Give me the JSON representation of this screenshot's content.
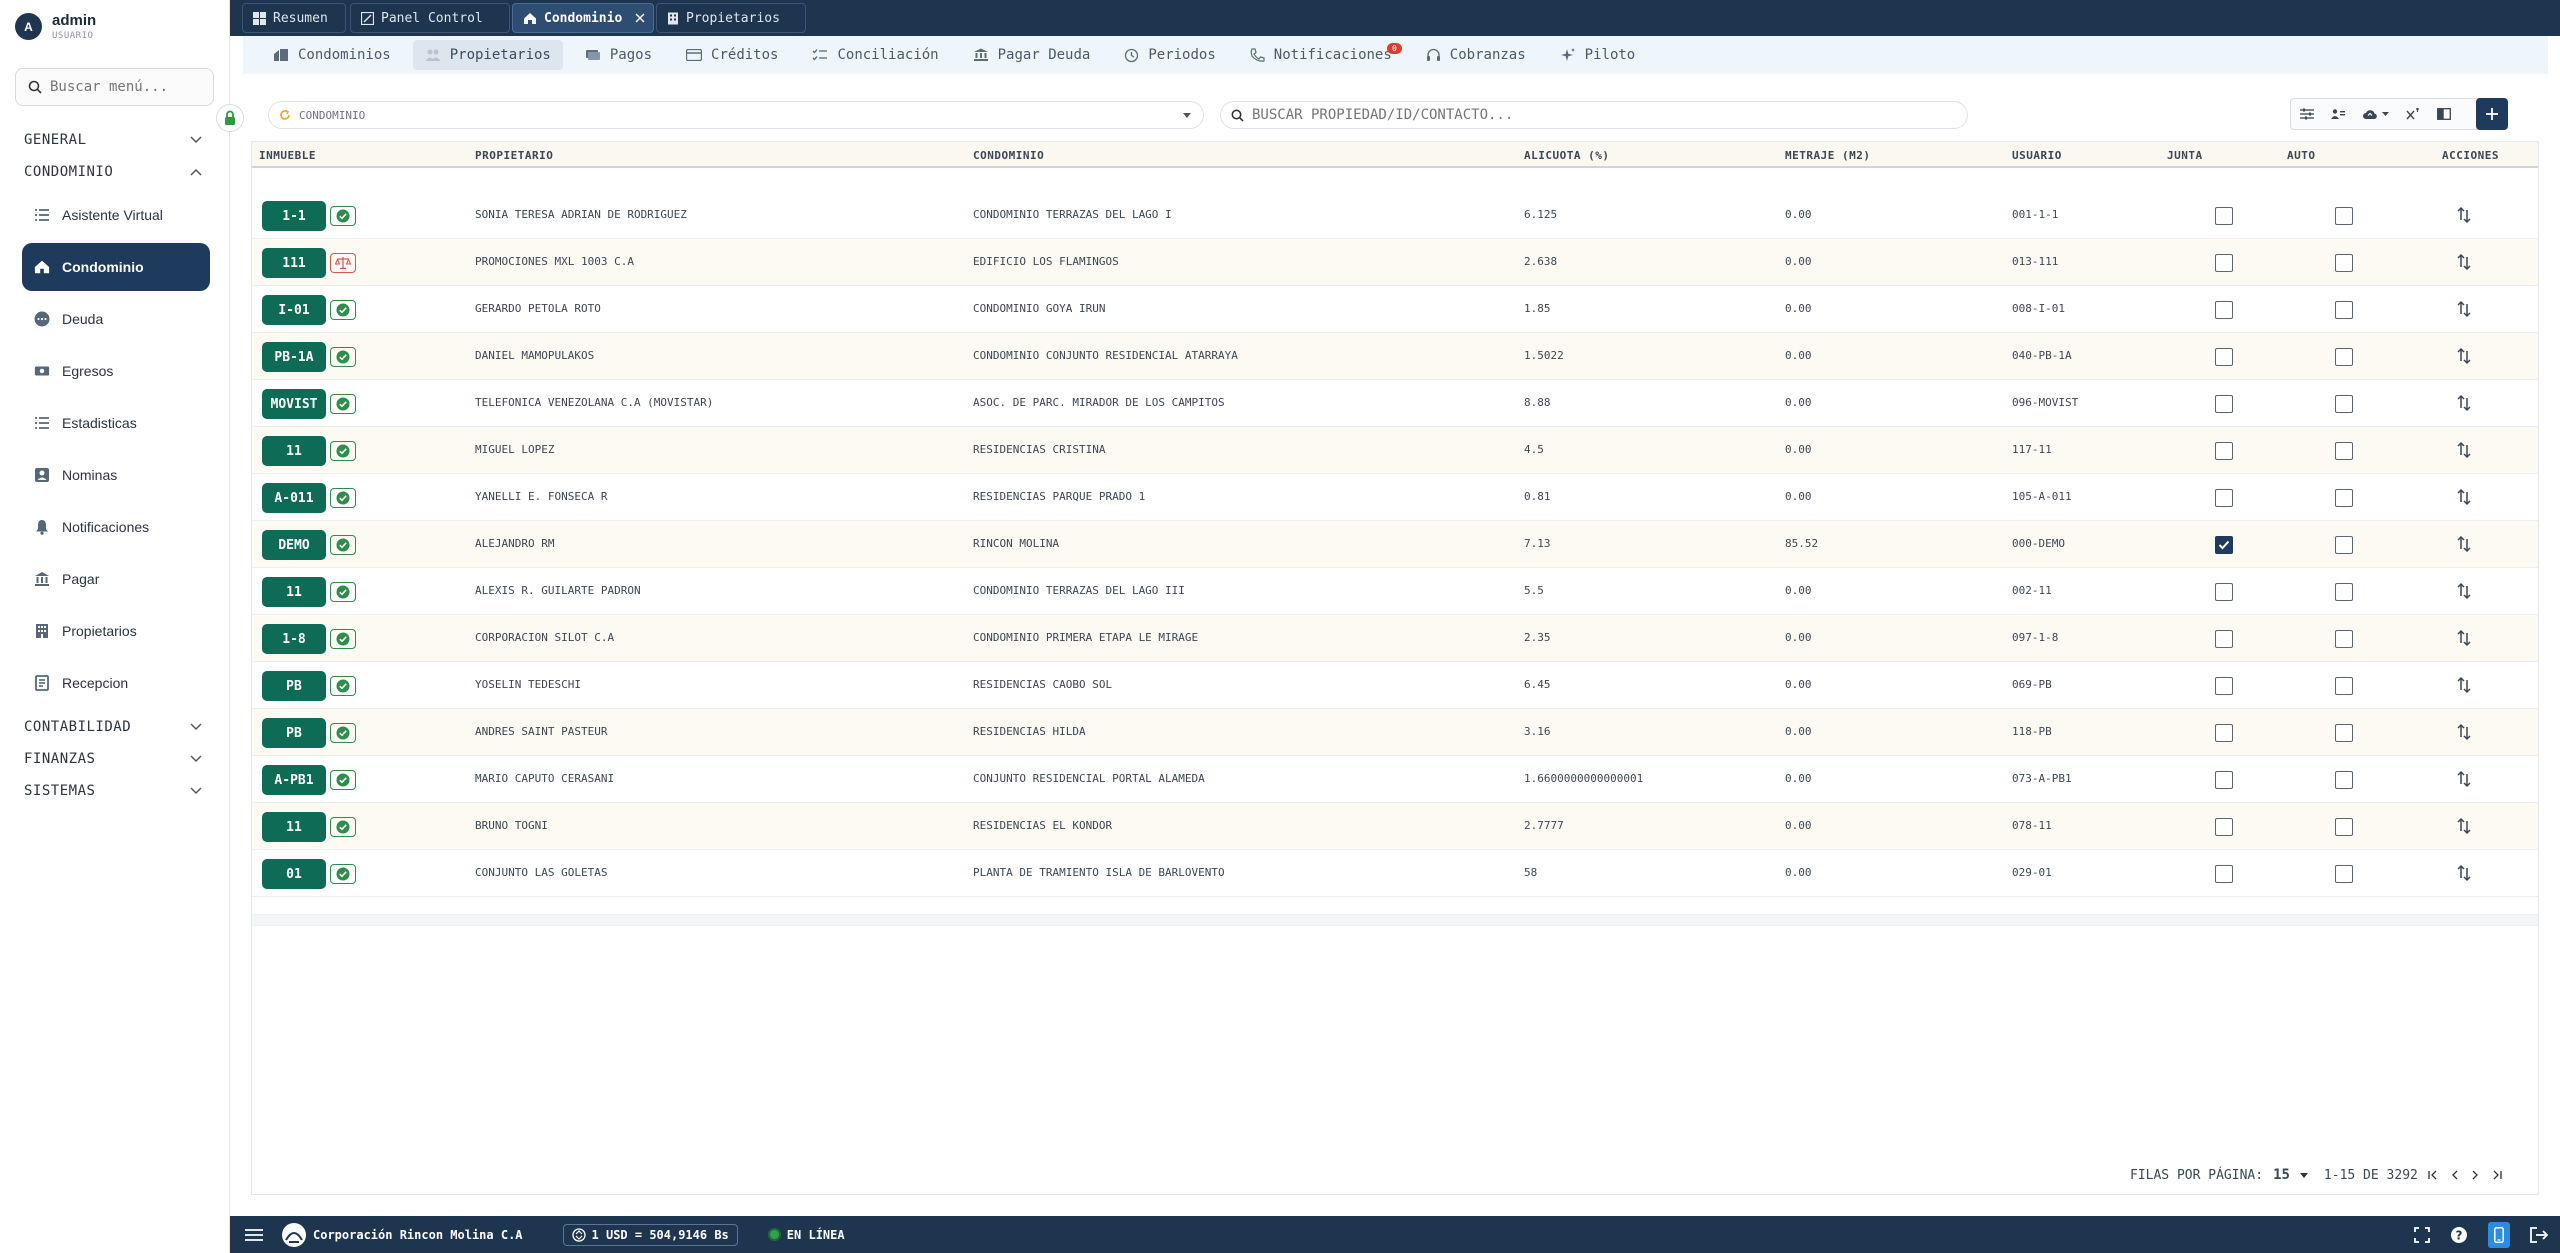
{
  "user": {
    "initial": "A",
    "name": "admin",
    "role": "USUARIO"
  },
  "sidebar": {
    "search_placeholder": "Buscar menú...",
    "groups": [
      "GENERAL",
      "CONDOMINIO",
      "CONTABILIDAD",
      "FINANZAS",
      "SISTEMAS"
    ],
    "items": [
      {
        "label": "Asistente Virtual",
        "icon": "list-icon"
      },
      {
        "label": "Condominio",
        "icon": "home-icon"
      },
      {
        "label": "Deuda",
        "icon": "dots-circle-icon"
      },
      {
        "label": "Egresos",
        "icon": "cash-icon"
      },
      {
        "label": "Estadisticas",
        "icon": "list-icon"
      },
      {
        "label": "Nominas",
        "icon": "id-card-icon"
      },
      {
        "label": "Notificaciones",
        "icon": "bell-icon"
      },
      {
        "label": "Pagar",
        "icon": "bank-icon"
      },
      {
        "label": "Propietarios",
        "icon": "building-icon"
      },
      {
        "label": "Recepcion",
        "icon": "receipt-icon"
      }
    ]
  },
  "top_tabs": [
    "Resumen",
    "Panel Control",
    "Condominio",
    "Propietarios"
  ],
  "sub_tabs": [
    "Condominios",
    "Propietarios",
    "Pagos",
    "Créditos",
    "Conciliación",
    "Pagar Deuda",
    "Periodos",
    "Notificaciones",
    "Cobranzas",
    "Piloto"
  ],
  "notif_badge": "0",
  "filters": {
    "condominio_placeholder": "CONDOMINIO",
    "search_placeholder": "BUSCAR PROPIEDAD/ID/CONTACTO..."
  },
  "table": {
    "headers": [
      "INMUEBLE",
      "PROPIETARIO",
      "CONDOMINIO",
      "ALICUOTA (%)",
      "METRAJE (M2)",
      "USUARIO",
      "JUNTA",
      "AUTO",
      "ACCIONES"
    ],
    "rows": [
      {
        "unit": "1-1",
        "owner": "SONIA TERESA ADRIAN DE RODRIGUEZ",
        "condo": "CONDOMINIO TERRAZAS DEL LAGO I",
        "alicuota": "6.125",
        "metraje": "0.00",
        "usuario": "001-1-1",
        "junta": false,
        "auto": false,
        "status": "ok"
      },
      {
        "unit": "111",
        "owner": "PROMOCIONES MXL 1003 C.A",
        "condo": "EDIFICIO LOS FLAMINGOS",
        "alicuota": "2.638",
        "metraje": "0.00",
        "usuario": "013-111",
        "junta": false,
        "auto": false,
        "status": "debt"
      },
      {
        "unit": "I-01",
        "owner": "GERARDO PETOLA ROTO",
        "condo": "CONDOMINIO GOYA IRUN",
        "alicuota": "1.85",
        "metraje": "0.00",
        "usuario": "008-I-01",
        "junta": false,
        "auto": false,
        "status": "ok"
      },
      {
        "unit": "PB-1A",
        "owner": "DANIEL MAMOPULAKOS",
        "condo": "CONDOMINIO CONJUNTO RESIDENCIAL ATARRAYA",
        "alicuota": "1.5022",
        "metraje": "0.00",
        "usuario": "040-PB-1A",
        "junta": false,
        "auto": false,
        "status": "ok"
      },
      {
        "unit": "MOVIST",
        "owner": "TELEFONICA VENEZOLANA C.A (MOVISTAR)",
        "condo": "ASOC. DE PARC. MIRADOR DE LOS CAMPITOS",
        "alicuota": "8.88",
        "metraje": "0.00",
        "usuario": "096-MOVIST",
        "junta": false,
        "auto": false,
        "status": "ok"
      },
      {
        "unit": "11",
        "owner": "MIGUEL LOPEZ",
        "condo": "RESIDENCIAS CRISTINA",
        "alicuota": "4.5",
        "metraje": "0.00",
        "usuario": "117-11",
        "junta": false,
        "auto": false,
        "status": "ok"
      },
      {
        "unit": "A-011",
        "owner": "YANELLI E. FONSECA R",
        "condo": "RESIDENCIAS PARQUE PRADO 1",
        "alicuota": "0.81",
        "metraje": "0.00",
        "usuario": "105-A-011",
        "junta": false,
        "auto": false,
        "status": "ok"
      },
      {
        "unit": "DEMO",
        "owner": "ALEJANDRO RM",
        "condo": "RINCON MOLINA",
        "alicuota": "7.13",
        "metraje": "85.52",
        "usuario": "000-DEMO",
        "junta": true,
        "auto": false,
        "status": "ok"
      },
      {
        "unit": "11",
        "owner": "ALEXIS R. GUILARTE PADRON",
        "condo": "CONDOMINIO TERRAZAS DEL LAGO III",
        "alicuota": "5.5",
        "metraje": "0.00",
        "usuario": "002-11",
        "junta": false,
        "auto": false,
        "status": "ok"
      },
      {
        "unit": "1-8",
        "owner": "CORPORACION SILOT C.A",
        "condo": "CONDOMINIO PRIMERA ETAPA LE MIRAGE",
        "alicuota": "2.35",
        "metraje": "0.00",
        "usuario": "097-1-8",
        "junta": false,
        "auto": false,
        "status": "ok"
      },
      {
        "unit": "PB",
        "owner": "YOSELIN TEDESCHI",
        "condo": "RESIDENCIAS CAOBO SOL",
        "alicuota": "6.45",
        "metraje": "0.00",
        "usuario": "069-PB",
        "junta": false,
        "auto": false,
        "status": "ok"
      },
      {
        "unit": "PB",
        "owner": "ANDRES SAINT PASTEUR",
        "condo": "RESIDENCIAS HILDA",
        "alicuota": "3.16",
        "metraje": "0.00",
        "usuario": "118-PB",
        "junta": false,
        "auto": false,
        "status": "ok"
      },
      {
        "unit": "A-PB1",
        "owner": "MARIO CAPUTO CERASANI",
        "condo": "CONJUNTO RESIDENCIAL PORTAL ALAMEDA",
        "alicuota": "1.6600000000000001",
        "metraje": "0.00",
        "usuario": "073-A-PB1",
        "junta": false,
        "auto": false,
        "status": "ok"
      },
      {
        "unit": "11",
        "owner": "BRUNO TOGNI",
        "condo": "RESIDENCIAS EL KONDOR",
        "alicuota": "2.7777",
        "metraje": "0.00",
        "usuario": "078-11",
        "junta": false,
        "auto": false,
        "status": "ok"
      },
      {
        "unit": "01",
        "owner": "CONJUNTO LAS GOLETAS",
        "condo": "PLANTA DE TRAMIENTO ISLA DE BARLOVENTO",
        "alicuota": "58",
        "metraje": "0.00",
        "usuario": "029-01",
        "junta": false,
        "auto": false,
        "status": "ok"
      }
    ]
  },
  "pagination": {
    "label": "FILAS POR PÁGINA:",
    "per_page": "15",
    "range": "1-15 DE 3292"
  },
  "footer": {
    "company": "Corporación Rincon Molina C.A",
    "rate": "1 USD = 504,9146 Bs",
    "status": "EN LÍNEA"
  },
  "colors": {
    "navy": "#1e3550",
    "accent": "#1e3a5c",
    "unit_green": "#0d6b56",
    "ok_green": "#2e8d4a",
    "debt_red": "#d9534f",
    "online": "#2ea34d"
  }
}
